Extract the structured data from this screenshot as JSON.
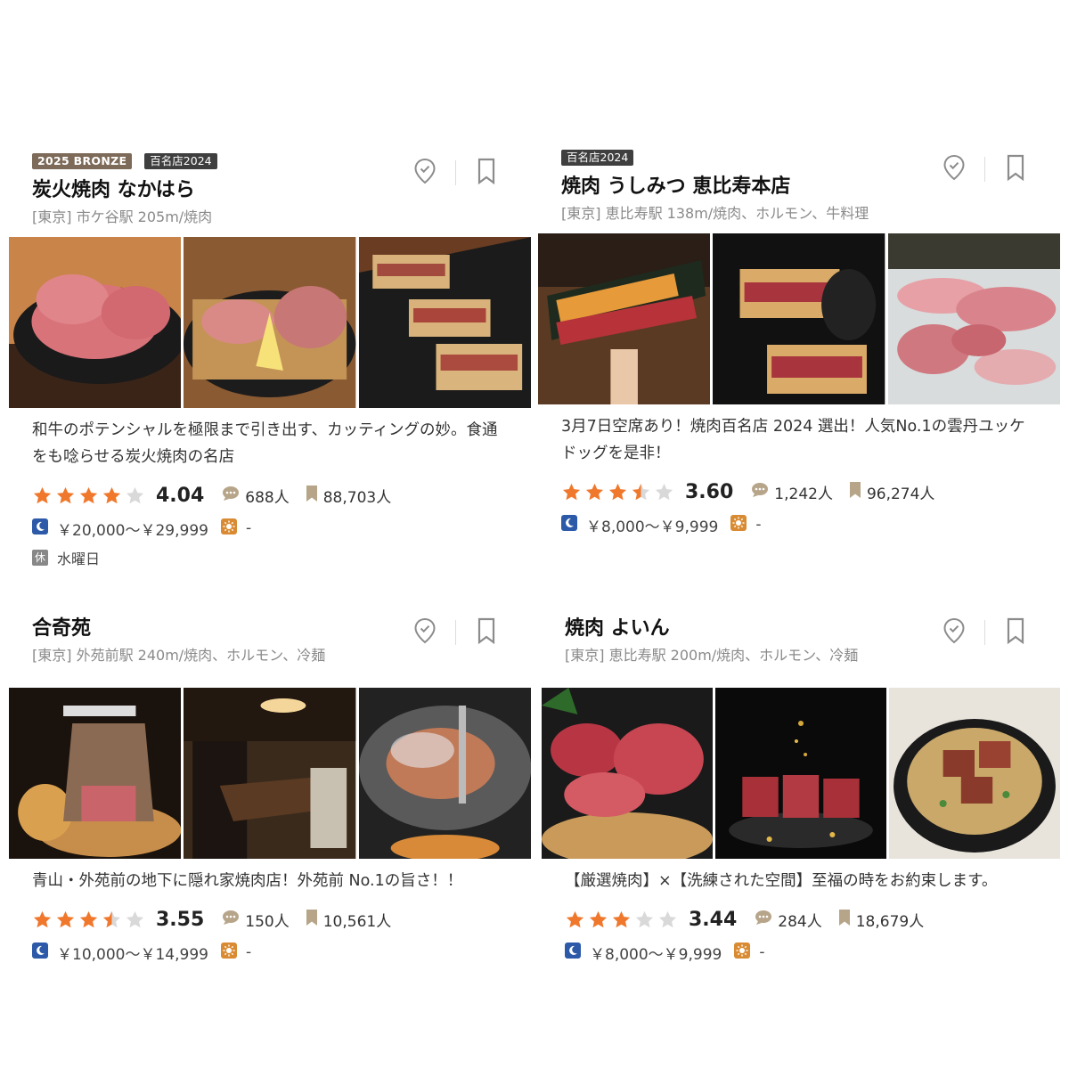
{
  "colors": {
    "star": "#f0782c",
    "star_empty": "#d9d9d9",
    "bronze": "#7d6a58",
    "hyaku": "#3f3f3f",
    "dinner_icon": "#2d5aa8",
    "lunch_icon": "#d98b33"
  },
  "icons": {
    "save": "map-pin-check-icon",
    "bookmark": "bookmark-icon",
    "review": "speech-bubble-icon",
    "saved": "bookmark-small-icon",
    "dinner": "moon-icon",
    "lunch": "sun-icon",
    "holiday": "rest-day-icon"
  },
  "restaurants": [
    {
      "badges": [
        "2025 BRONZE",
        "百名店2024"
      ],
      "name": "炭火焼肉 なかはら",
      "location": "[東京] 市ケ谷駅 205m/焼肉",
      "description": "和牛のポテンシャルを極限まで引き出す、カッティングの妙。食通をも唸らせる炭火焼肉の名店",
      "rating": 4.04,
      "score": "4.04",
      "reviews": "688人",
      "saves": "88,703人",
      "dinner_price": "￥20,000～￥29,999",
      "lunch_price": "-",
      "holiday": "水曜日",
      "holiday_icon": "休"
    },
    {
      "badges": [
        "百名店2024"
      ],
      "name": "焼肉 うしみつ 恵比寿本店",
      "location": "[東京] 恵比寿駅 138m/焼肉、ホルモン、牛料理",
      "description": "3月7日空席あり！焼肉百名店 2024 選出！人気No.1の雲丹ユッケドッグを是非！",
      "rating": 3.6,
      "score": "3.60",
      "reviews": "1,242人",
      "saves": "96,274人",
      "dinner_price": "￥8,000～￥9,999",
      "lunch_price": "-"
    },
    {
      "badges": [],
      "name": "合奇苑",
      "location": "[東京] 外苑前駅 240m/焼肉、ホルモン、冷麺",
      "description": "青山・外苑前の地下に隠れ家焼肉店！外苑前 No.1の旨さ！！",
      "rating": 3.55,
      "score": "3.55",
      "reviews": "150人",
      "saves": "10,561人",
      "dinner_price": "￥10,000～￥14,999",
      "lunch_price": "-"
    },
    {
      "badges": [],
      "name": "焼肉 よいん",
      "location": "[東京] 恵比寿駅 200m/焼肉、ホルモン、冷麺",
      "description": "【厳選焼肉】×【洗練された空間】至福の時をお約束します。",
      "rating": 3.44,
      "score": "3.44",
      "reviews": "284人",
      "saves": "18,679人",
      "dinner_price": "￥8,000～￥9,999",
      "lunch_price": "-"
    }
  ],
  "photo_subjects": [
    [
      "sliced-wagyu-plate-photo",
      "beef-tongue-with-lemon-photo",
      "beef-katsu-sando-photo"
    ],
    [
      "uni-yukke-dog-photo",
      "wagyu-katsu-sando-photo",
      "wagyu-platter-photo"
    ],
    [
      "shaved-meat-roll-photo",
      "private-dining-room-photo",
      "grilling-meat-photo"
    ],
    [
      "premium-beef-cuts-photo",
      "gold-leaf-beef-photo",
      "beef-rice-pot-photo"
    ]
  ]
}
